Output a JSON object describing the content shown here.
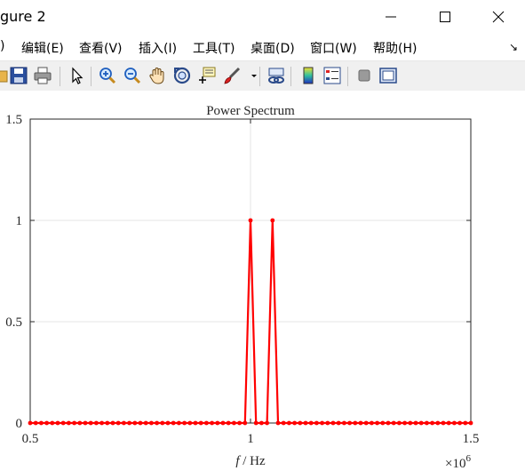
{
  "window": {
    "title": "gure 2"
  },
  "menu": {
    "items": [
      {
        "label": ")"
      },
      {
        "label": "编辑(E)"
      },
      {
        "label": "查看(V)"
      },
      {
        "label": "插入(I)"
      },
      {
        "label": "工具(T)"
      },
      {
        "label": "桌面(D)"
      },
      {
        "label": "窗口(W)"
      },
      {
        "label": "帮助(H)"
      }
    ],
    "overflow": "↘"
  },
  "colors": {
    "accent_red": "#ff0000",
    "grid": "#e5e5e5",
    "axis": "#262626"
  },
  "chart_data": {
    "type": "line",
    "title": "Power Spectrum",
    "xlabel_italic": "f",
    "xlabel_rest": " / Hz",
    "ylabel": "",
    "xlim": [
      500000,
      1500000
    ],
    "ylim": [
      0,
      1.5
    ],
    "x_exponent_label": "×10",
    "x_exponent_power": "6",
    "xticks": [
      {
        "value": 500000,
        "label": "0.5"
      },
      {
        "value": 1000000,
        "label": "1"
      },
      {
        "value": 1500000,
        "label": "1.5"
      }
    ],
    "yticks": [
      {
        "value": 0,
        "label": "0"
      },
      {
        "value": 0.5,
        "label": "0.5"
      },
      {
        "value": 1,
        "label": "1"
      },
      {
        "value": 1.5,
        "label": "1.5"
      }
    ],
    "grid": true,
    "marker": "point",
    "series": [
      {
        "color": "#ff0000",
        "x_start": 500000,
        "x_step": 12500,
        "y": [
          0,
          0,
          0,
          0,
          0,
          0,
          0,
          0,
          0,
          0,
          0,
          0,
          0,
          0,
          0,
          0,
          0,
          0,
          0,
          0,
          0,
          0,
          0,
          0,
          0,
          0,
          0,
          0,
          0,
          0,
          0,
          0,
          0,
          0,
          0,
          0,
          0,
          0,
          0,
          0,
          1,
          0,
          0,
          0,
          1,
          0,
          0,
          0,
          0,
          0,
          0,
          0,
          0,
          0,
          0,
          0,
          0,
          0,
          0,
          0,
          0,
          0,
          0,
          0,
          0,
          0,
          0,
          0,
          0,
          0,
          0,
          0,
          0,
          0,
          0,
          0,
          0,
          0,
          0,
          0,
          0
        ]
      }
    ]
  }
}
